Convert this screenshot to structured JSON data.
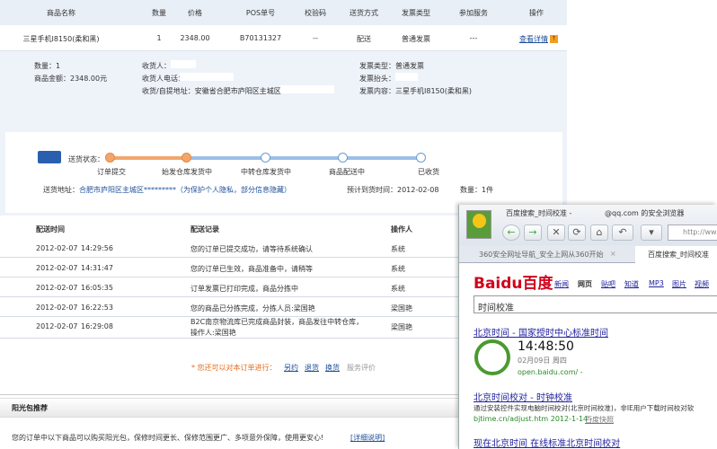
{
  "table_header": [
    "商品名称",
    "数量",
    "价格",
    "POS单号",
    "校验码",
    "送货方式",
    "发票类型",
    "参加服务",
    "操作"
  ],
  "product": {
    "name": "三星手机I8150(柔和黑)",
    "qty": "1",
    "price": "2348.00",
    "pos": "B70131327",
    "check": "--",
    "delivery": "配送",
    "invoice": "普通发票",
    "service": "---",
    "action": "查看详情"
  },
  "details": {
    "qty": "数量：1",
    "amount": "商品金额：2348.00元",
    "receiver": "收货人：",
    "phone": "收货人电话：",
    "address": "收货/自提地址：安徽省合肥市庐阳区主城区",
    "invoice_type": "发票类型：普通发票",
    "invoice_title": "发票抬头：",
    "invoice_content": "发票内容：三星手机I8150(柔和黑)"
  },
  "status": {
    "label": "送货状态：",
    "steps": [
      "订单提交",
      "始发仓库发货中",
      "中转仓库发货中",
      "商品配送中",
      "已收货"
    ],
    "completed": 2,
    "address_label": "送货地址：",
    "address": "合肥市庐阳区主城区*********（为保护个人隐私，部分信息隐藏）",
    "eta": "预计到货时间：2012-02-08",
    "count": "数量：1件"
  },
  "log": {
    "headers": [
      "配送时间",
      "配送记录",
      "操作人"
    ],
    "rows": [
      {
        "date": "2012-02-07",
        "time": "14:29:56",
        "record": "您的订单已提交成功，请等待系统确认",
        "op": "系统"
      },
      {
        "date": "2012-02-07",
        "time": "14:31:47",
        "record": "您的订单已生效，商品准备中，请稍等",
        "op": "系统"
      },
      {
        "date": "2012-02-07",
        "time": "16:05:35",
        "record": "订单发票已打印完成，商品分拣中",
        "op": "系统"
      },
      {
        "date": "2012-02-07",
        "time": "16:22:53",
        "record": "您的商品已分拣完成，分拣人员:梁国艳",
        "op": "梁国艳"
      },
      {
        "date": "2012-02-07",
        "time": "16:29:08",
        "record": "B2C南京物流库已完成商品封装，商品发往中转仓库，操作人:梁国艳",
        "op": "梁国艳"
      }
    ]
  },
  "actions": {
    "prompt": "* 您还可以对本订单进行：",
    "links": [
      "另约",
      "退货",
      "换货"
    ],
    "disabled": "服务评价"
  },
  "sunshine": {
    "title": "阳光包推荐",
    "text": "您的订单中以下商品可以购买阳光包，保修时间更长、保修范围更广、多项意外保障，使用更安心!",
    "link": "[详细说明]"
  },
  "browser": {
    "title": "百度搜索_时间校准 -",
    "title2": "@qq.com 的安全浏览器",
    "url": "http://www",
    "tabs": [
      "360安全网址导航_安全上网从360开始",
      "百度搜索_时间校准"
    ],
    "baidu": {
      "logo": "Baidu百度",
      "nav": [
        "新闻",
        "网页",
        "贴吧",
        "知道",
        "MP3",
        "图片",
        "视频"
      ],
      "query": "时间校准",
      "results": [
        {
          "title": "北京时间 - 国家授时中心标准时间",
          "time": "14:48:50",
          "date": "02月09日   周四",
          "url": "open.baidu.com/ - "
        },
        {
          "title": "北京时间校对 - 时钟校准",
          "desc": "通过安装控件实现电脑时间校对(北京时间校准)，非IE用户下载时间校对软",
          "url": "bjtime.cn/adjust.htm 2012-1-14 - ",
          "cache": "百度快照"
        },
        {
          "title": "现在北京时间 在线标准北京时间校对"
        }
      ]
    }
  },
  "colors": {
    "header_bg": "#e9eff7",
    "progress_done": "#f3a56b",
    "progress_todo": "#9cc0e6",
    "link": "#1e4f9a",
    "baidu_red": "#d0021b"
  }
}
